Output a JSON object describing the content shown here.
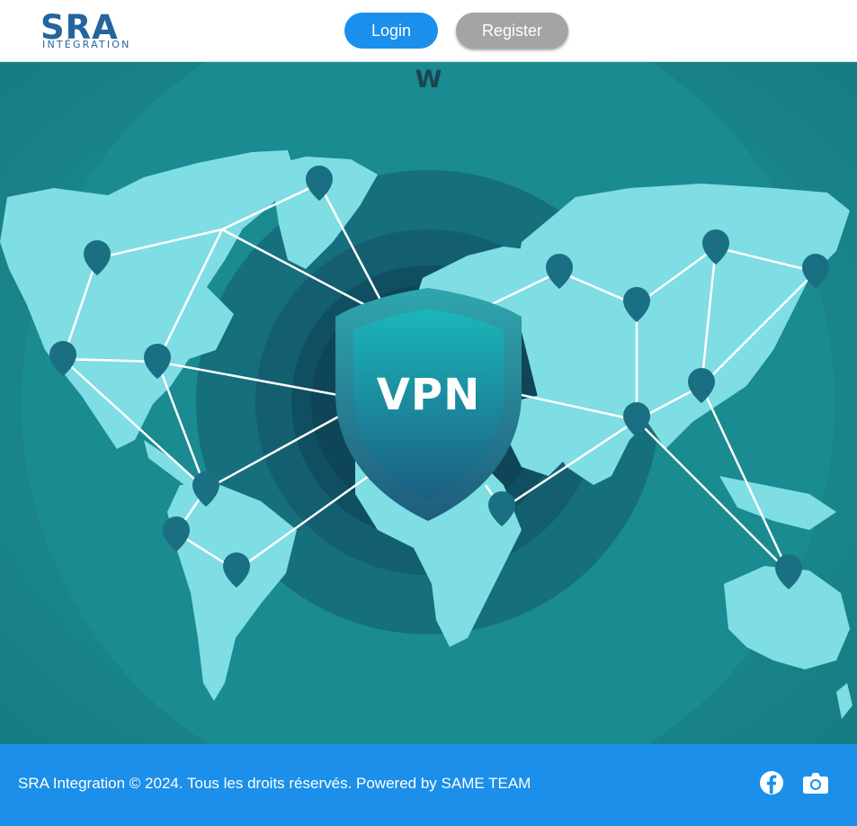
{
  "header": {
    "logo_mark": "SRA",
    "logo_sub": "INTÉGRATION",
    "login_label": "Login",
    "register_label": "Register"
  },
  "hero": {
    "letter": "W",
    "shield_text": "VPN",
    "icon": "world-map-vpn-network-illustration"
  },
  "footer": {
    "copyright": "SRA Integration © 2024. Tous les droits réservés. Powered by SAME TEAM",
    "social": [
      {
        "name": "facebook",
        "icon": "facebook-icon"
      },
      {
        "name": "instagram",
        "icon": "camera-icon"
      }
    ]
  },
  "colors": {
    "brand": "#24659c",
    "login_button": "#1a8fec",
    "register_button": "#a3a4a5",
    "hero_bg": "#1b8a8e",
    "continents": "#7fdde4",
    "pins": "#1a6f82",
    "footer_bg": "#1b8fe9"
  }
}
